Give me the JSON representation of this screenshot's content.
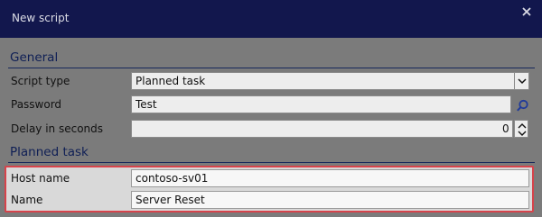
{
  "window": {
    "title": "New script"
  },
  "sections": {
    "general": "General",
    "planned_task": "Planned task"
  },
  "fields": {
    "script_type": {
      "label": "Script type",
      "value": "Planned task"
    },
    "password": {
      "label": "Password",
      "value": "Test"
    },
    "delay": {
      "label": "Delay in seconds",
      "value": "0"
    },
    "host_name": {
      "label": "Host name",
      "value": "contoso-sv01"
    },
    "name": {
      "label": "Name",
      "value": "Server Reset"
    }
  },
  "icons": {
    "close": "close-icon",
    "dropdown": "chevron-down-icon",
    "search": "search-icon",
    "spinner": "spinner-icon"
  },
  "colors": {
    "titlebar": "#12174d",
    "section_text": "#0f1f55",
    "highlight": "#d6434b"
  }
}
